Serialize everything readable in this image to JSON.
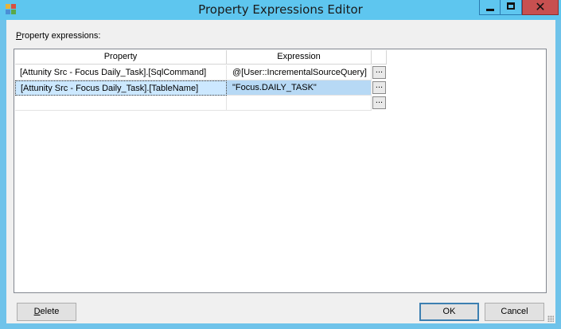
{
  "window": {
    "title": "Property Expressions Editor",
    "close_glyph": "✕",
    "icons": {
      "app": "app-icon",
      "minimize": "minimize-icon",
      "maximize": "maximize-icon",
      "close": "close-icon"
    }
  },
  "dialog": {
    "label_prefix": "P",
    "label_rest": "roperty expressions:",
    "grid": {
      "columns": [
        "Property",
        "Expression",
        ""
      ],
      "rows": [
        {
          "property": "[Attunity Src - Focus Daily_Task].[SqlCommand]",
          "expression": "@[User::IncrementalSourceQuery]",
          "button": "...",
          "selected": false
        },
        {
          "property": "[Attunity Src - Focus Daily_Task].[TableName]",
          "expression": "\"Focus.DAILY_TASK\"",
          "button": "...",
          "selected": true
        },
        {
          "property": "",
          "expression": "",
          "button": "...",
          "selected": false
        }
      ]
    },
    "buttons": {
      "delete_prefix": "D",
      "delete_rest": "elete",
      "ok": "OK",
      "cancel": "Cancel"
    }
  },
  "colors": {
    "titlebar": "#5ec6ef",
    "close_button": "#c75050",
    "selection": "#cce8ff"
  }
}
